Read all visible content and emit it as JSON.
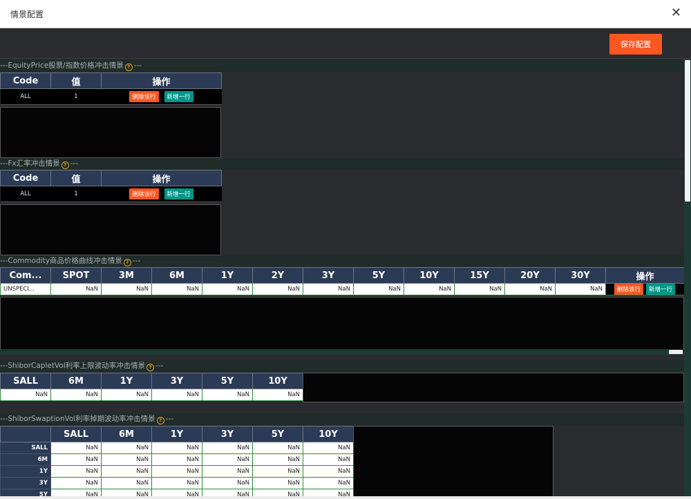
{
  "window": {
    "title": "情景配置"
  },
  "toolbar": {
    "save_label": "保存配置"
  },
  "common": {
    "delete_label": "删除该行",
    "add_label": "新增一行"
  },
  "sections": {
    "equity": {
      "title_prefix": "---EquityPrice股票/指数价格冲击情景",
      "title_suffix": "---",
      "columns": [
        "Code",
        "值",
        "操作"
      ],
      "row": {
        "code": "ALL",
        "value": "1"
      }
    },
    "fx": {
      "title_prefix": "---Fx汇率冲击情景",
      "title_suffix": "---",
      "columns": [
        "Code",
        "值",
        "操作"
      ],
      "row": {
        "code": "ALL",
        "value": "1"
      }
    },
    "commodity": {
      "title_prefix": "---Commodity商品价格曲线冲击情景",
      "title_suffix": "---",
      "columns": [
        "Com...",
        "SPOT",
        "3M",
        "6M",
        "1Y",
        "2Y",
        "3Y",
        "5Y",
        "10Y",
        "15Y",
        "20Y",
        "30Y",
        "操作"
      ],
      "row": [
        "UNSPECI...",
        "NaN",
        "NaN",
        "NaN",
        "NaN",
        "NaN",
        "NaN",
        "NaN",
        "NaN",
        "NaN",
        "NaN",
        "NaN"
      ]
    },
    "caplet": {
      "title_prefix": "---ShiborCapletVol利率上限波动率冲击情景",
      "title_suffix": "---",
      "columns": [
        "SALL",
        "6M",
        "1Y",
        "3Y",
        "5Y",
        "10Y"
      ],
      "row": [
        "NaN",
        "NaN",
        "NaN",
        "NaN",
        "NaN",
        "NaN"
      ]
    },
    "swaption": {
      "title_prefix": "---ShiborSwaptionVol利率掉期波动率冲击情景",
      "title_suffix": "---",
      "columns": [
        "SALL",
        "6M",
        "1Y",
        "3Y",
        "5Y",
        "10Y"
      ],
      "rows": [
        {
          "label": "SALL",
          "values": [
            "NaN",
            "NaN",
            "NaN",
            "NaN",
            "NaN",
            "NaN"
          ]
        },
        {
          "label": "6M",
          "values": [
            "NaN",
            "NaN",
            "NaN",
            "NaN",
            "NaN",
            "NaN"
          ]
        },
        {
          "label": "1Y",
          "values": [
            "NaN",
            "NaN",
            "NaN",
            "NaN",
            "NaN",
            "NaN"
          ]
        },
        {
          "label": "3Y",
          "values": [
            "NaN",
            "NaN",
            "NaN",
            "NaN",
            "NaN",
            "NaN"
          ]
        },
        {
          "label": "5Y",
          "values": [
            "NaN",
            "NaN",
            "NaN",
            "NaN",
            "NaN",
            "NaN"
          ]
        }
      ]
    }
  },
  "colors": {
    "accent": "#fb5722",
    "add": "#009688",
    "header": "#2c3b55",
    "grid": "#2b8c3a"
  }
}
